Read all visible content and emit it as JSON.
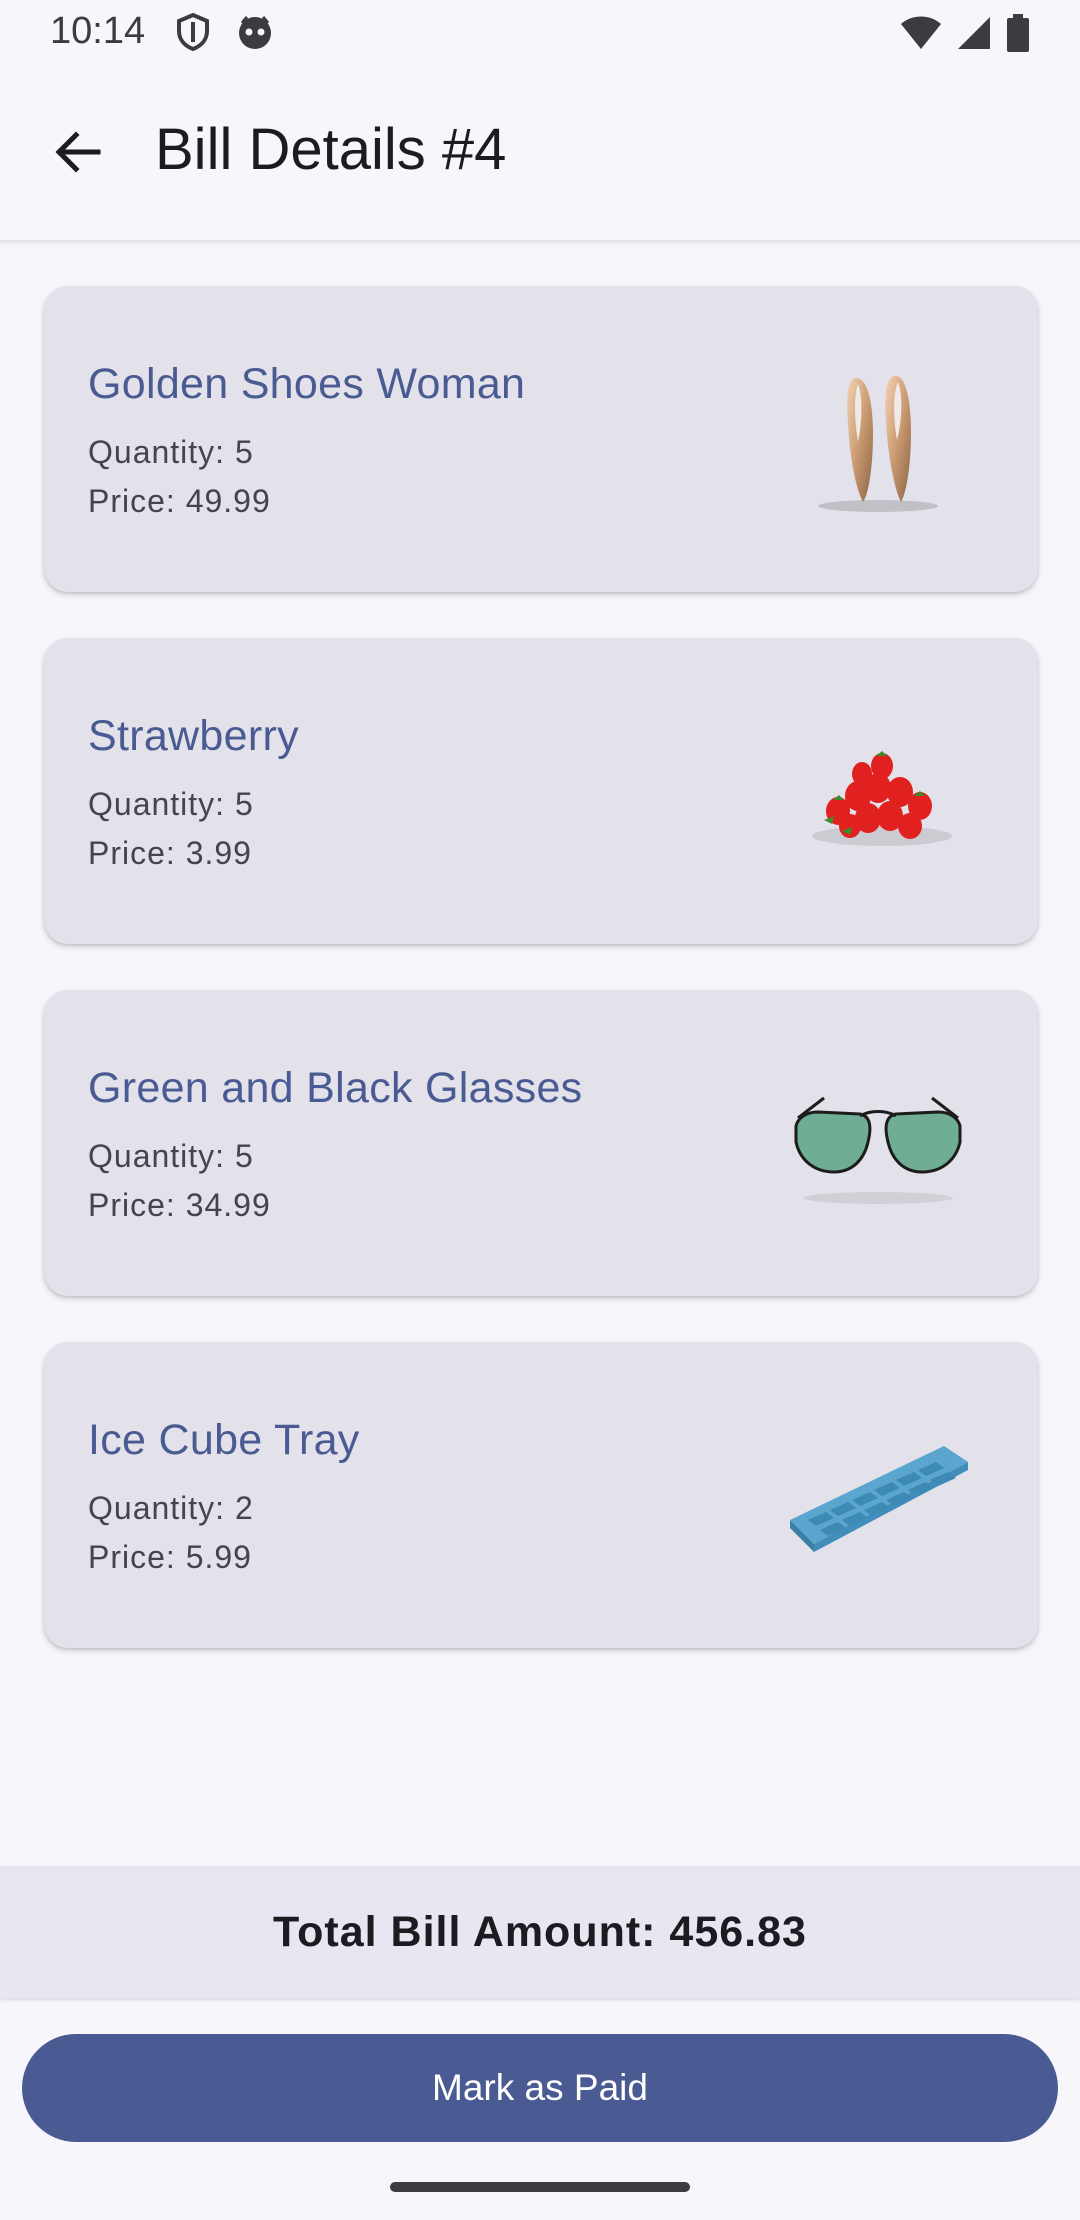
{
  "status_bar": {
    "time": "10:14",
    "icons": [
      "shield-icon",
      "face-icon",
      "wifi-icon",
      "signal-icon",
      "battery-icon"
    ]
  },
  "app_bar": {
    "title": "Bill Details #4",
    "back_icon": "arrow-back-icon"
  },
  "items": [
    {
      "name": "Golden Shoes Woman",
      "quantity": "Quantity: 5",
      "price": "Price: 49.99",
      "image_icon": "golden-shoes-image"
    },
    {
      "name": "Strawberry",
      "quantity": "Quantity: 5",
      "price": "Price: 3.99",
      "image_icon": "strawberry-image"
    },
    {
      "name": "Green and Black Glasses",
      "quantity": "Quantity: 5",
      "price": "Price: 34.99",
      "image_icon": "glasses-image"
    },
    {
      "name": "Ice Cube Tray",
      "quantity": "Quantity: 2",
      "price": "Price: 5.99",
      "image_icon": "ice-cube-tray-image"
    }
  ],
  "total": {
    "label": "Total Bill Amount: 456.83"
  },
  "actions": {
    "mark_paid_label": "Mark as Paid"
  },
  "colors": {
    "accent": "#4a5a92",
    "card_bg": "#e3e2ea",
    "background": "#f7f6fb"
  }
}
